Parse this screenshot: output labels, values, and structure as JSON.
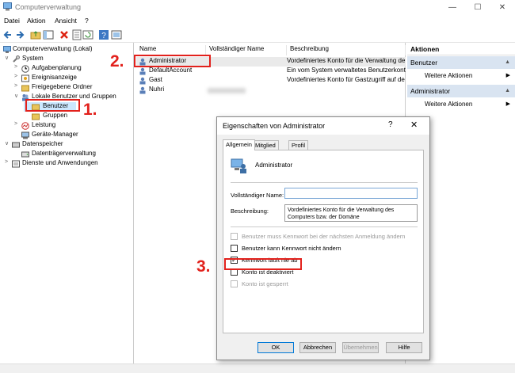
{
  "window": {
    "title": "Computerverwaltung",
    "min_glyph": "—",
    "max_glyph": "☐",
    "close_glyph": "✕"
  },
  "menu": [
    "Datei",
    "Aktion",
    "Ansicht",
    "?"
  ],
  "toolbar_icons": [
    "back-icon",
    "forward-icon",
    "folder-up-icon",
    "show-hide-tree-icon",
    "delete-icon",
    "properties-icon",
    "refresh-icon",
    "export-icon",
    "help-icon",
    "console-icon"
  ],
  "tree": [
    {
      "label": "Computerverwaltung (Lokal)",
      "expander": "",
      "icon": "computer-icon",
      "indent": 0
    },
    {
      "label": "System",
      "expander": "∨",
      "icon": "tools-icon",
      "indent": 1
    },
    {
      "label": "Aufgabenplanung",
      "expander": ">",
      "icon": "clock-icon",
      "indent": 2
    },
    {
      "label": "Ereignisanzeige",
      "expander": ">",
      "icon": "event-viewer-icon",
      "indent": 2
    },
    {
      "label": "Freigegebene Ordner",
      "expander": ">",
      "icon": "shared-folder-icon",
      "indent": 2
    },
    {
      "label": "Lokale Benutzer und Gruppen",
      "expander": "∨",
      "icon": "users-icon",
      "indent": 2
    },
    {
      "label": "Benutzer",
      "expander": "",
      "icon": "folder-icon",
      "indent": 3
    },
    {
      "label": "Gruppen",
      "expander": "",
      "icon": "folder-icon",
      "indent": 3
    },
    {
      "label": "Leistung",
      "expander": ">",
      "icon": "performance-icon",
      "indent": 2
    },
    {
      "label": "Geräte-Manager",
      "expander": "",
      "icon": "device-manager-icon",
      "indent": 2
    },
    {
      "label": "Datenspeicher",
      "expander": "∨",
      "icon": "storage-icon",
      "indent": 1
    },
    {
      "label": "Datenträgerverwaltung",
      "expander": "",
      "icon": "disk-icon",
      "indent": 2
    },
    {
      "label": "Dienste und Anwendungen",
      "expander": ">",
      "icon": "services-icon",
      "indent": 1
    }
  ],
  "list": {
    "columns": [
      "Name",
      "Vollständiger Name",
      "Beschreibung"
    ],
    "rows": [
      {
        "name": "Administrator",
        "fullname": "",
        "description": "Vordefiniertes Konto für die Verwaltung de"
      },
      {
        "name": "DefaultAccount",
        "fullname": "",
        "description": "Ein vom System verwaltetes Benutzerkonto"
      },
      {
        "name": "Gast",
        "fullname": "",
        "description": "Vordefiniertes Konto für Gastzugriff auf de"
      },
      {
        "name": "Nuhri",
        "fullname": "",
        "description": ""
      }
    ]
  },
  "actions": {
    "title": "Aktionen",
    "sections": [
      {
        "header": "Benutzer",
        "caret": "▲",
        "item": "Weitere Aktionen",
        "arrow": "▶"
      },
      {
        "header": "Administrator",
        "caret": "▲",
        "item": "Weitere Aktionen",
        "arrow": "▶"
      }
    ]
  },
  "dialog": {
    "title": "Eigenschaften von Administrator",
    "help_glyph": "?",
    "close_glyph": "✕",
    "tabs": [
      "Allgemein",
      "Mitglied von",
      "Profil"
    ],
    "account_name": "Administrator",
    "fullname_label": "Vollständiger Name:",
    "fullname_value": "",
    "description_label": "Beschreibung:",
    "description_value": "Vordefiniertes Konto für die Verwaltung des Computers bzw. der Domäne",
    "checkboxes": [
      {
        "label": "Benutzer muss Kennwort bei der nächsten Anmeldung ändern",
        "checked": false,
        "disabled": true,
        "mark": ""
      },
      {
        "label": "Benutzer kann Kennwort nicht ändern",
        "checked": false,
        "disabled": false,
        "mark": ""
      },
      {
        "label": "Kennwort läuft nie ab",
        "checked": true,
        "disabled": false,
        "mark": "✓"
      },
      {
        "label": "Konto ist deaktiviert",
        "checked": false,
        "disabled": false,
        "mark": ""
      },
      {
        "label": "Konto ist gesperrt",
        "checked": false,
        "disabled": true,
        "mark": ""
      }
    ],
    "buttons": [
      "OK",
      "Abbrechen",
      "Übernehmen",
      "Hilfe"
    ]
  },
  "annotations": [
    "1.",
    "2.",
    "3."
  ],
  "colors": {
    "annotation": "#e2211c",
    "selection": "#cce8ff",
    "actions_section": "#d9e4f1",
    "focus_blue": "#0078d7"
  }
}
